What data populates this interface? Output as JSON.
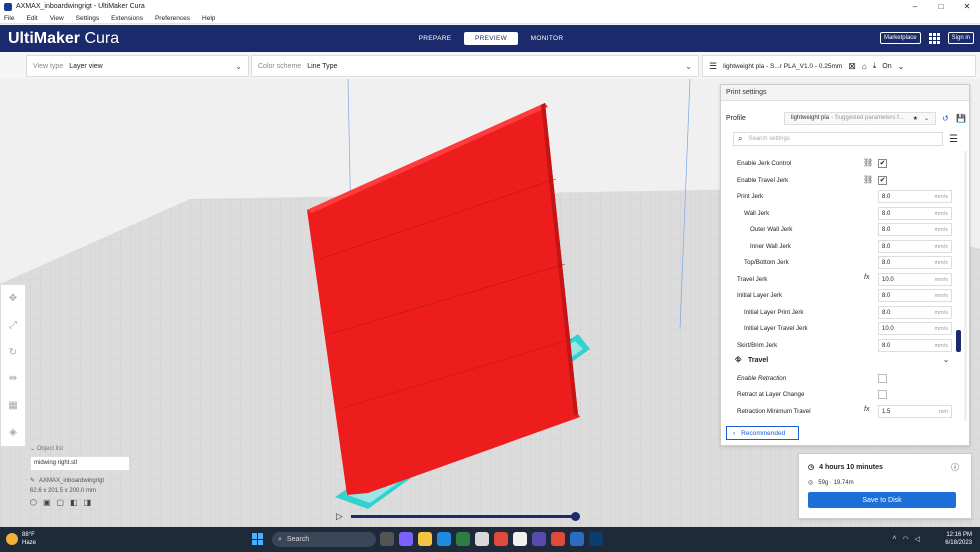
{
  "window": {
    "title": "AXMAX_inboardwingrigt - UltiMaker Cura"
  },
  "menu": [
    "File",
    "Edit",
    "View",
    "Settings",
    "Extensions",
    "Preferences",
    "Help"
  ],
  "header": {
    "brand_bold": "UltiMaker",
    "brand_light": " Cura",
    "stages": [
      {
        "label": "PREPARE",
        "active": false
      },
      {
        "label": "PREVIEW",
        "active": true
      },
      {
        "label": "MONITOR",
        "active": false
      }
    ],
    "marketplace": "Marketplace",
    "signin": "Sign in"
  },
  "toolbar": {
    "view_type_label": "View type",
    "view_type_value": "Layer view",
    "color_scheme_label": "Color scheme",
    "color_scheme_value": "Line Type",
    "print_profile": "lightweight pla - S...r PLA_V1.0 - 0.25mm",
    "support_state": "On"
  },
  "object_list": {
    "header": "Object list",
    "object_name": "midwing right.stl",
    "file_name": "AXMAX_inboardwingrigt",
    "dimensions": "62.6 x 201.5 x 200.0 mm"
  },
  "print_settings": {
    "title": "Print settings",
    "profile_label": "Profile",
    "profile_value": "lightweight pla",
    "profile_suffix": "- Suggested parameters f...",
    "search_placeholder": "Search settings",
    "settings": [
      {
        "name": "Enable Jerk Control",
        "type": "checkbox",
        "checked": true,
        "indent": 0,
        "link": true
      },
      {
        "name": "Enable Travel Jerk",
        "type": "checkbox",
        "checked": true,
        "indent": 0,
        "link": true
      },
      {
        "name": "Print Jerk",
        "type": "number",
        "value": "8.0",
        "unit": "mm/s",
        "indent": 0
      },
      {
        "name": "Wall Jerk",
        "type": "number",
        "value": "8.0",
        "unit": "mm/s",
        "indent": 1
      },
      {
        "name": "Outer Wall Jerk",
        "type": "number",
        "value": "8.0",
        "unit": "mm/s",
        "indent": 2
      },
      {
        "name": "Inner Wall Jerk",
        "type": "number",
        "value": "8.0",
        "unit": "mm/s",
        "indent": 2
      },
      {
        "name": "Top/Bottom Jerk",
        "type": "number",
        "value": "8.0",
        "unit": "mm/s",
        "indent": 1
      },
      {
        "name": "Travel Jerk",
        "type": "number",
        "value": "10.0",
        "unit": "mm/s",
        "indent": 0,
        "fx": true
      },
      {
        "name": "Initial Layer Jerk",
        "type": "number",
        "value": "8.0",
        "unit": "mm/s",
        "indent": 0
      },
      {
        "name": "Initial Layer Print Jerk",
        "type": "number",
        "value": "8.0",
        "unit": "mm/s",
        "indent": 1
      },
      {
        "name": "Initial Layer Travel Jerk",
        "type": "number",
        "value": "10.0",
        "unit": "mm/s",
        "indent": 1
      },
      {
        "name": "Skirt/Brim Jerk",
        "type": "number",
        "value": "8.0",
        "unit": "mm/s",
        "indent": 0
      }
    ],
    "travel_category": "Travel",
    "travel_settings": [
      {
        "name": "Enable Retraction",
        "type": "checkbox",
        "checked": false,
        "italic": true
      },
      {
        "name": "Retract at Layer Change",
        "type": "checkbox",
        "checked": false
      },
      {
        "name": "Retraction Minimum Travel",
        "type": "number",
        "value": "1.5",
        "unit": "mm",
        "fx": true
      }
    ],
    "recommended_button": "Recommended"
  },
  "estimate": {
    "time": "4 hours 10 minutes",
    "material": "59g · 19.74m",
    "save_button": "Save to Disk"
  },
  "taskbar": {
    "temperature": "88°F",
    "weather": "Haze",
    "search": "Search",
    "time": "12:16 PM",
    "date": "6/18/2023"
  }
}
